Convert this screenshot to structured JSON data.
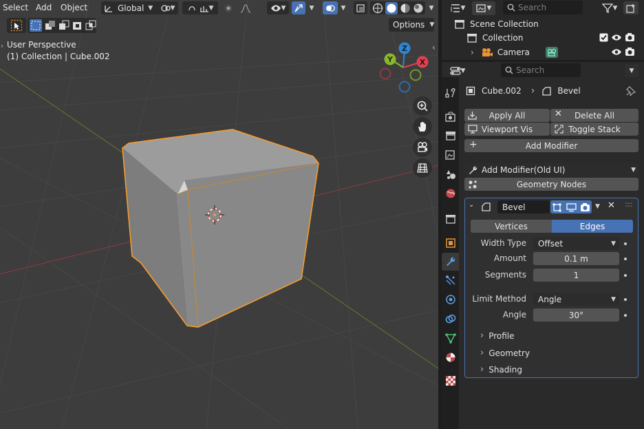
{
  "viewport": {
    "menu": [
      "Select",
      "Add",
      "Object"
    ],
    "orientation_label": "Global",
    "options_label": "Options",
    "info_line1": "User Perspective",
    "info_line2": "(1) Collection | Cube.002",
    "gizmo_labels": {
      "z": "Z",
      "y": "Y",
      "x": "X"
    }
  },
  "outliner": {
    "search_placeholder": "Search",
    "items": [
      {
        "label": "Scene Collection"
      },
      {
        "label": "Collection"
      },
      {
        "label": "Camera"
      }
    ]
  },
  "properties": {
    "search_placeholder": "Search",
    "breadcrumb_object": "Cube.002",
    "breadcrumb_modifier": "Bevel",
    "apply_all": "Apply All",
    "delete_all": "Delete All",
    "viewport_vis": "Viewport Vis",
    "toggle_stack": "Toggle Stack",
    "add_modifier": "Add Modifier",
    "add_modifier_old": "Add Modifier(Old UI)",
    "geometry_nodes": "Geometry Nodes",
    "modifier": {
      "name": "Bevel",
      "tab_vertices": "Vertices",
      "tab_edges": "Edges",
      "active_tab": "Edges",
      "width_type_label": "Width Type",
      "width_type_value": "Offset",
      "amount_label": "Amount",
      "amount_value": "0.1 m",
      "segments_label": "Segments",
      "segments_value": "1",
      "limit_method_label": "Limit Method",
      "limit_method_value": "Angle",
      "angle_label": "Angle",
      "angle_value": "30°",
      "sections": [
        "Profile",
        "Geometry",
        "Shading"
      ]
    }
  },
  "colors": {
    "accent": "#4772b3",
    "selection_outline": "#f39c2f",
    "axis_x": "#e0414e",
    "axis_y": "#8ab72d",
    "axis_z": "#2f86d4"
  }
}
